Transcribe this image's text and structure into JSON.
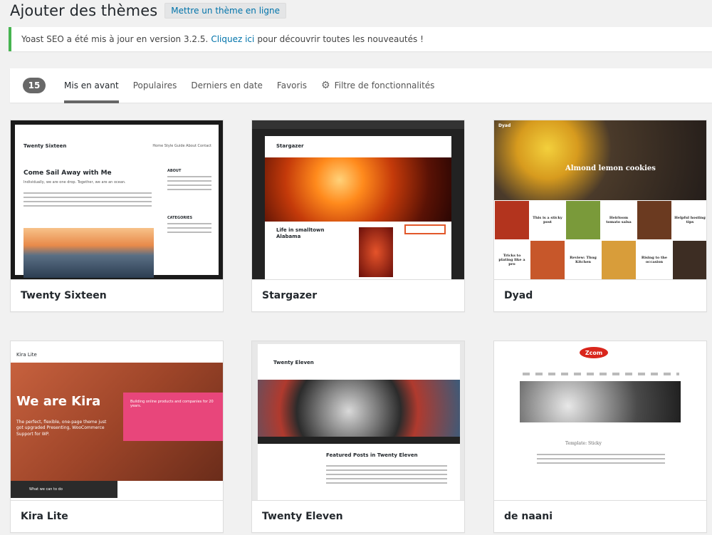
{
  "header": {
    "title": "Ajouter des thèmes",
    "upload_button": "Mettre un thème en ligne"
  },
  "notice": {
    "prefix": "Yoast SEO a été mis à jour en version 3.2.5.",
    "link": "Cliquez ici",
    "suffix": "pour découvrir toutes les nouveautés !"
  },
  "filters": {
    "count": "15",
    "tabs": [
      "Mis en avant",
      "Populaires",
      "Derniers en date",
      "Favoris"
    ],
    "feature_filter": "Filtre de fonctionnalités"
  },
  "themes": [
    {
      "name": "Twenty Sixteen",
      "preview": {
        "site_title": "Twenty Sixteen",
        "nav": "Home   Style Guide   About   Contact",
        "headline": "Come Sail Away with Me",
        "subhead": "Individually, we are one drop. Together, we are an ocean.",
        "sidebar_heading": "ABOUT",
        "categories_heading": "CATEGORIES"
      }
    },
    {
      "name": "Stargazer",
      "preview": {
        "site_title": "Stargazer",
        "post_title": "Life in smalltown Alabama"
      }
    },
    {
      "name": "Dyad",
      "preview": {
        "site_title": "Dyad",
        "hero_caption": "Almond lemon cookies",
        "tiles": [
          "This is a sticky post",
          "Heirloom tomato salsa",
          "Helpful hosting tips",
          "Tricks to plating like a pro",
          "Review: Thug Kitchen",
          "Rising to the occasion"
        ]
      }
    },
    {
      "name": "Kira Lite",
      "preview": {
        "logo": "Kira Lite",
        "headline": "We are Kira",
        "subhead": "The perfect, flexible, one-page theme just got upgraded Presenting, WooCommerce Support for WP.",
        "card_text": "Building online products and companies for 20 years.",
        "footer_label": "What we can to do"
      }
    },
    {
      "name": "Twenty Eleven",
      "preview": {
        "site_title": "Twenty Eleven",
        "post_title": "Featured Posts in Twenty Eleven"
      }
    },
    {
      "name": "de naani",
      "preview": {
        "logo": "Zcom",
        "post_title": "Template: Sticky"
      }
    }
  ]
}
